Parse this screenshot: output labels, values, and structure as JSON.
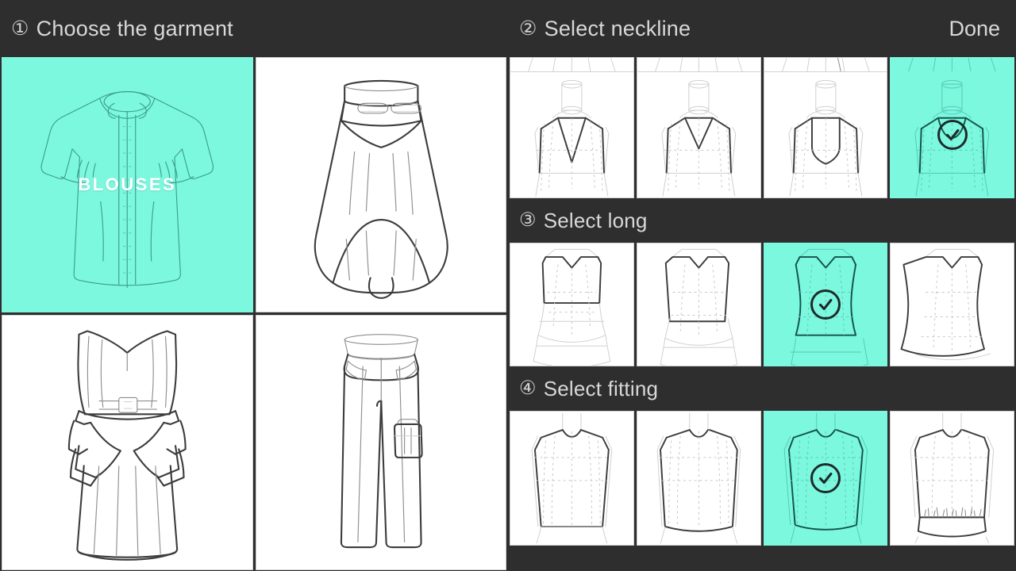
{
  "accent_color": "#7cf8df",
  "header_bg": "#2e2e2e",
  "header_text_color": "#d8d8d8",
  "left_panel": {
    "step_number": "①",
    "title": "Choose the garment",
    "garments": [
      {
        "name": "blouse",
        "label": "BLOUSES",
        "selected": true,
        "icon": "blouse-sketch"
      },
      {
        "name": "skirt",
        "label": "",
        "selected": false,
        "icon": "high-low-skirt-sketch"
      },
      {
        "name": "dress",
        "label": "",
        "selected": false,
        "icon": "strapless-dress-sketch"
      },
      {
        "name": "pants",
        "label": "",
        "selected": false,
        "icon": "cargo-pants-sketch"
      }
    ]
  },
  "right_panel": {
    "done_label": "Done",
    "sections": [
      {
        "step_number": "②",
        "title": "Select neckline",
        "row_name": "neckline",
        "options": [
          {
            "name": "deep-v-neck",
            "selected": false,
            "icon": "deep-v-neckline-sketch"
          },
          {
            "name": "shallow-v-neck",
            "selected": false,
            "icon": "shallow-v-neckline-sketch"
          },
          {
            "name": "sweetheart-neck",
            "selected": false,
            "icon": "sweetheart-neckline-sketch"
          },
          {
            "name": "scoop-neck",
            "selected": true,
            "icon": "scoop-neckline-sketch"
          }
        ]
      },
      {
        "step_number": "③",
        "title": "Select long",
        "row_name": "length",
        "options": [
          {
            "name": "cropped-length",
            "selected": false,
            "icon": "cropped-bodice-sketch"
          },
          {
            "name": "short-length",
            "selected": false,
            "icon": "short-bodice-sketch"
          },
          {
            "name": "waist-length",
            "selected": true,
            "icon": "waist-bodice-sketch"
          },
          {
            "name": "hip-length",
            "selected": false,
            "icon": "hip-bodice-sketch"
          }
        ]
      },
      {
        "step_number": "④",
        "title": "Select fitting",
        "row_name": "fitting",
        "options": [
          {
            "name": "straight-fit",
            "selected": false,
            "icon": "straight-fit-sketch"
          },
          {
            "name": "relaxed-fit",
            "selected": false,
            "icon": "relaxed-fit-sketch"
          },
          {
            "name": "boxy-fit",
            "selected": true,
            "icon": "boxy-fit-sketch"
          },
          {
            "name": "gathered-hem",
            "selected": false,
            "icon": "gathered-hem-sketch"
          }
        ]
      }
    ]
  }
}
